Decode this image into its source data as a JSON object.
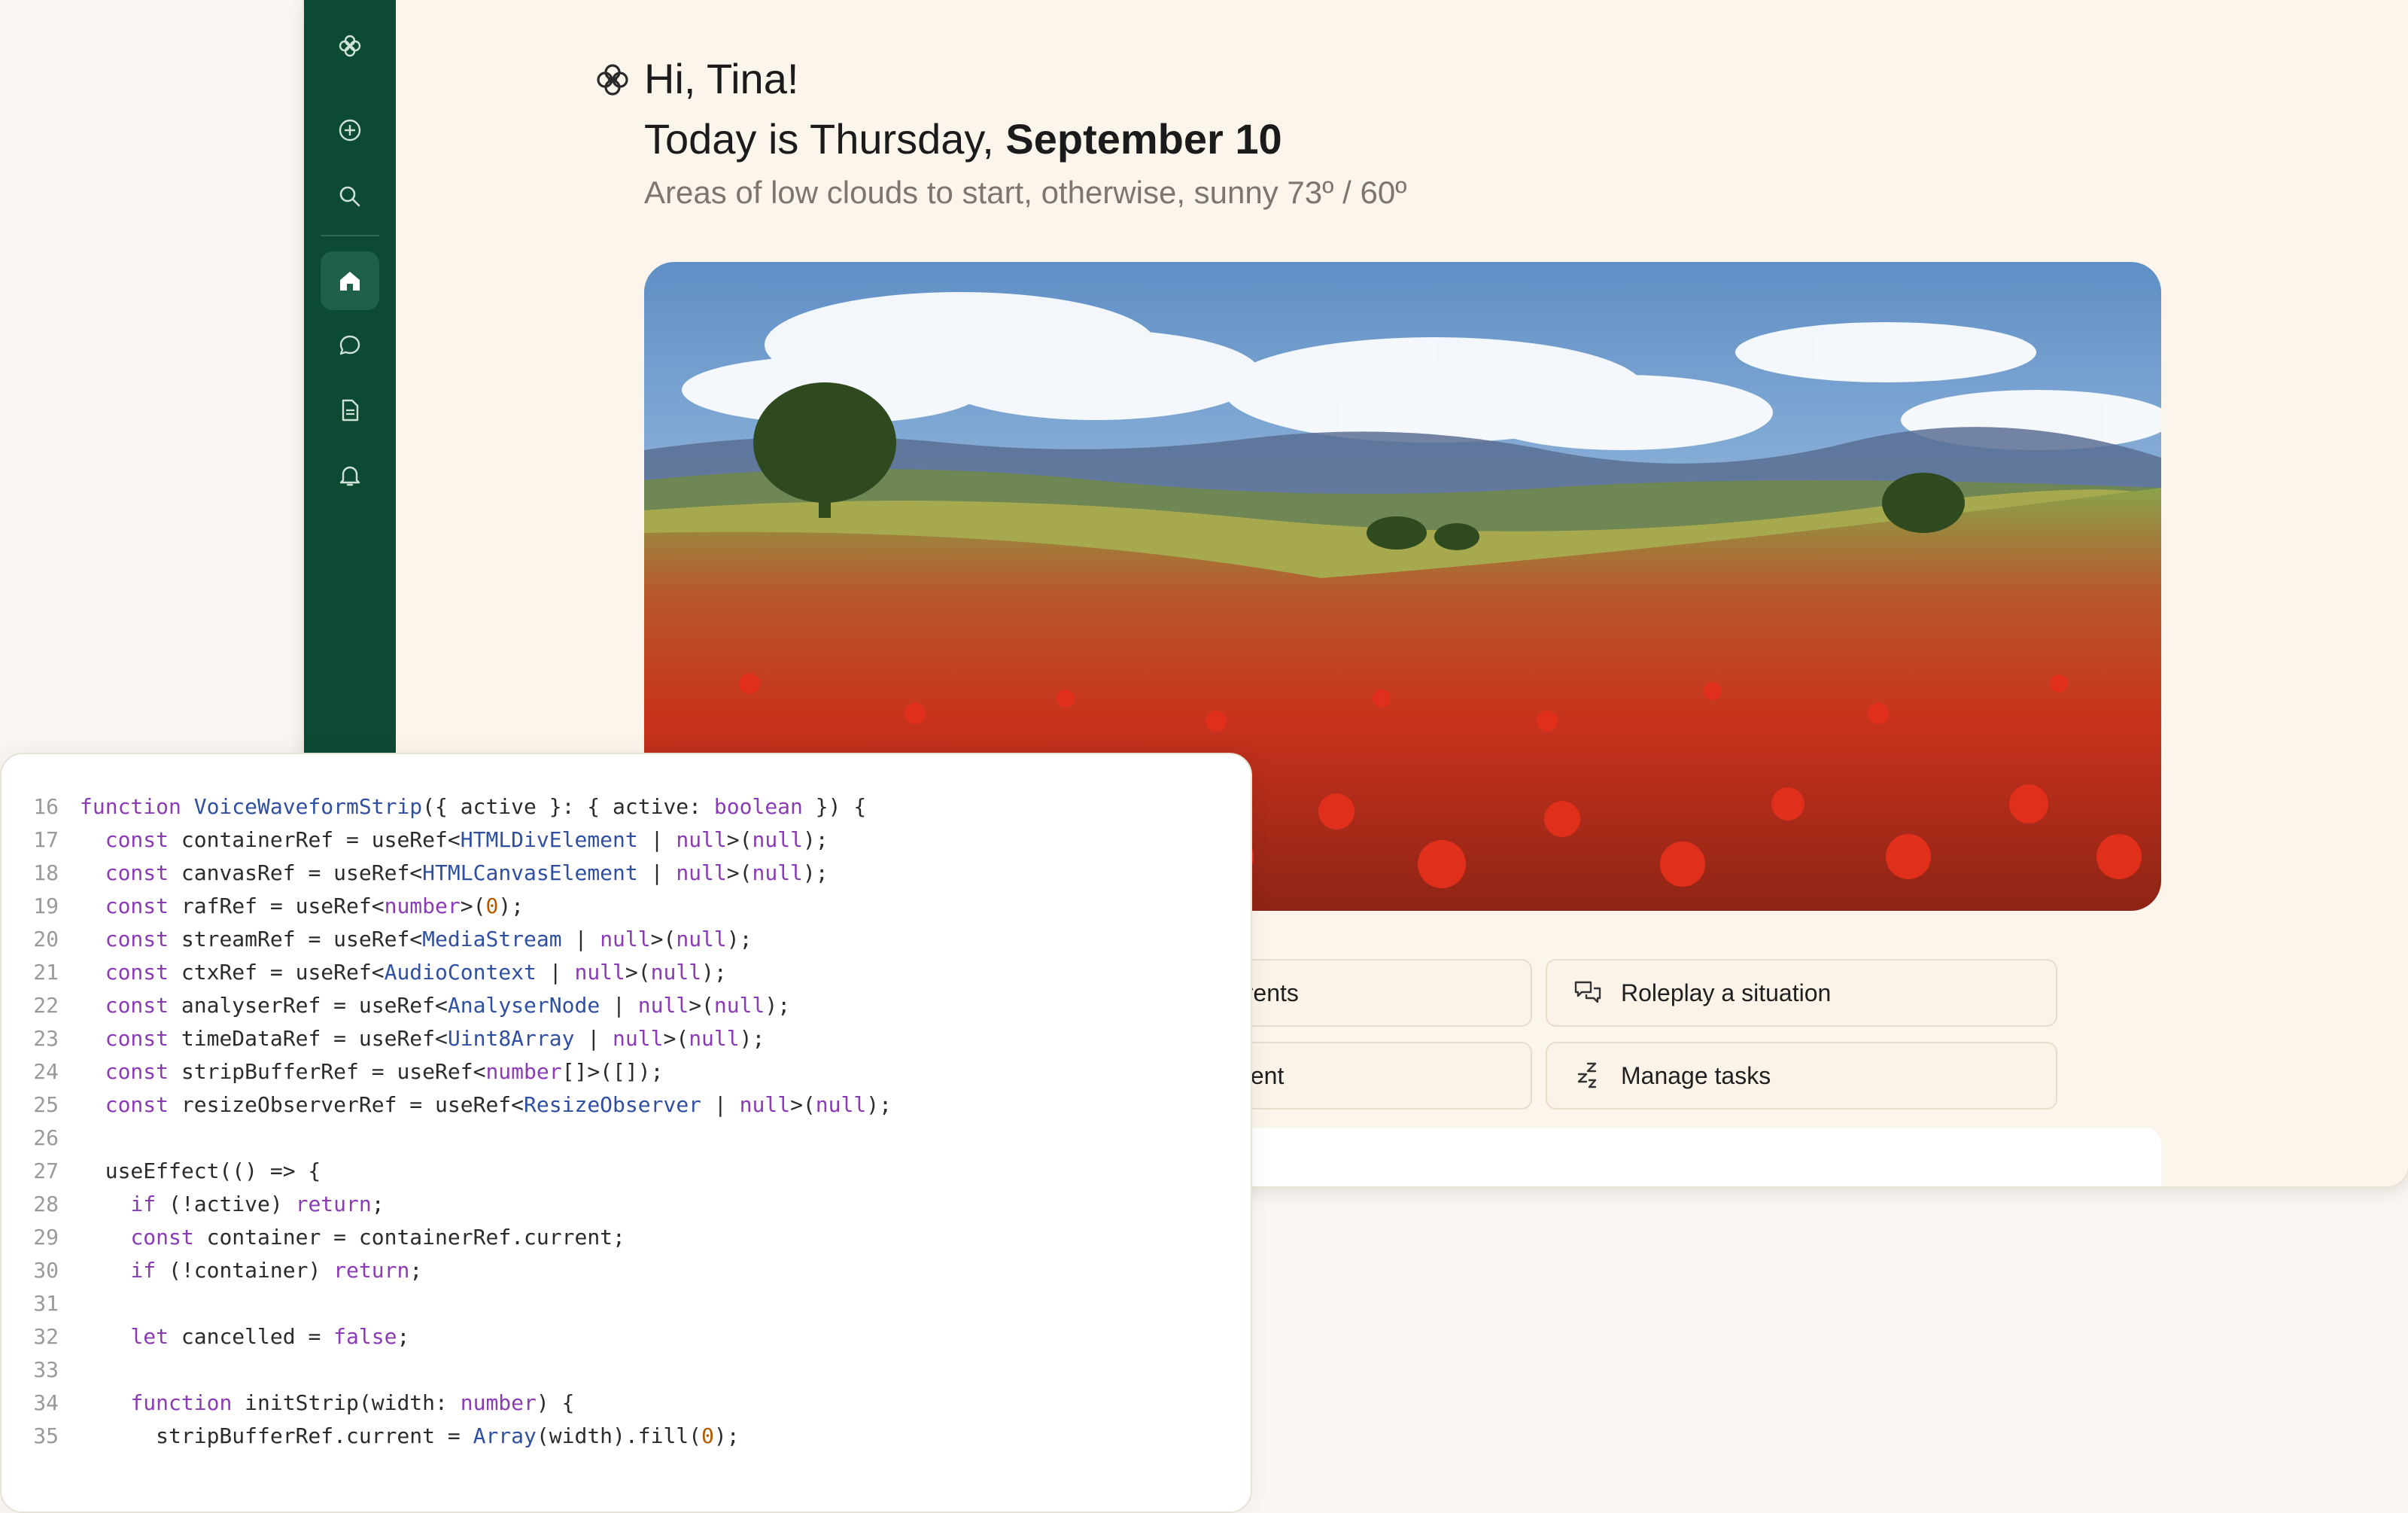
{
  "greeting": {
    "hello": "Hi, Tina!",
    "date_prefix": "Today is Thursday,",
    "date_bold": "September 10",
    "weather": "Areas of low clouds to start, otherwise, sunny 73º / 60º"
  },
  "sidebar": {
    "items": [
      {
        "name": "logo-icon"
      },
      {
        "name": "new-chat-icon"
      },
      {
        "name": "search-icon"
      },
      {
        "name": "home-icon",
        "active": true
      },
      {
        "name": "chat-icon"
      },
      {
        "name": "document-icon"
      },
      {
        "name": "bell-icon"
      }
    ]
  },
  "suggestions": [
    {
      "label": "te to parents",
      "icon": "none"
    },
    {
      "label": "Roleplay a situation",
      "icon": "chat-bubbles-icon"
    },
    {
      "label": "apt content",
      "icon": "none"
    },
    {
      "label": "Manage tasks",
      "icon": "zzz-icon"
    }
  ],
  "code": {
    "lines": [
      {
        "n": "16",
        "text": "function VoiceWaveformStrip({ active }: { active: boolean }) {"
      },
      {
        "n": "17",
        "text": "  const containerRef = useRef<HTMLDivElement | null>(null);"
      },
      {
        "n": "18",
        "text": "  const canvasRef = useRef<HTMLCanvasElement | null>(null);"
      },
      {
        "n": "19",
        "text": "  const rafRef = useRef<number>(0);"
      },
      {
        "n": "20",
        "text": "  const streamRef = useRef<MediaStream | null>(null);"
      },
      {
        "n": "21",
        "text": "  const ctxRef = useRef<AudioContext | null>(null);"
      },
      {
        "n": "22",
        "text": "  const analyserRef = useRef<AnalyserNode | null>(null);"
      },
      {
        "n": "23",
        "text": "  const timeDataRef = useRef<Uint8Array | null>(null);"
      },
      {
        "n": "24",
        "text": "  const stripBufferRef = useRef<number[]>([]);"
      },
      {
        "n": "25",
        "text": "  const resizeObserverRef = useRef<ResizeObserver | null>(null);"
      },
      {
        "n": "26",
        "text": ""
      },
      {
        "n": "27",
        "text": "  useEffect(() => {"
      },
      {
        "n": "28",
        "text": "    if (!active) return;"
      },
      {
        "n": "29",
        "text": "    const container = containerRef.current;"
      },
      {
        "n": "30",
        "text": "    if (!container) return;"
      },
      {
        "n": "31",
        "text": ""
      },
      {
        "n": "32",
        "text": "    let cancelled = false;"
      },
      {
        "n": "33",
        "text": ""
      },
      {
        "n": "34",
        "text": "    function initStrip(width: number) {"
      },
      {
        "n": "35",
        "text": "      stripBufferRef.current = Array(width).fill(0);"
      }
    ]
  },
  "colors": {
    "sidebar": "#0d4a33",
    "sidebar_active": "#1f6148",
    "keyword": "#8a3bb5",
    "type": "#2f4fa0",
    "number": "#b35a00"
  }
}
